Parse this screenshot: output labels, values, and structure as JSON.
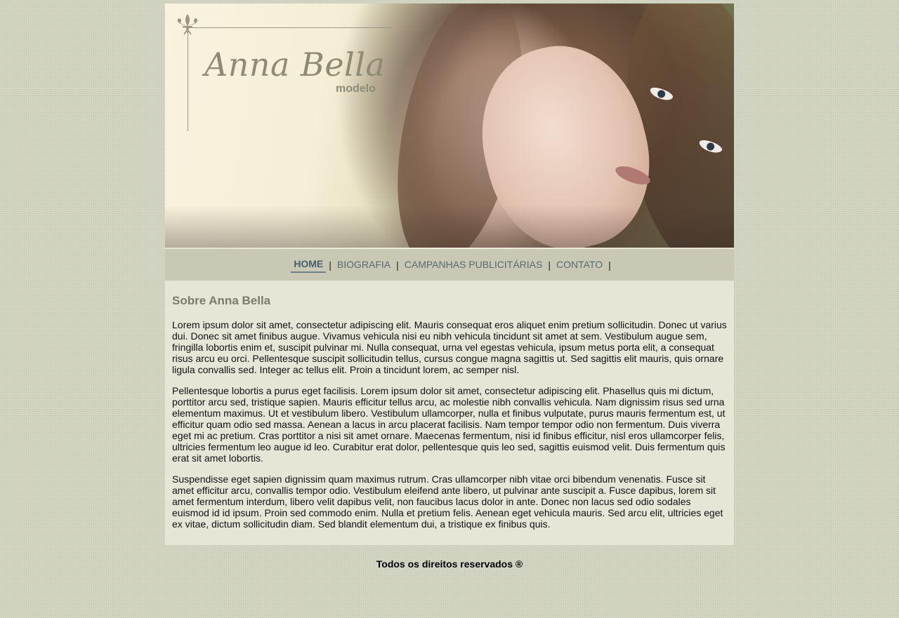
{
  "brand": {
    "name": "Anna Bella",
    "subtitle": "modelo"
  },
  "nav": {
    "items": [
      {
        "label": "HOME",
        "active": true
      },
      {
        "label": "BIOGRAFIA",
        "active": false
      },
      {
        "label": "CAMPANHAS PUBLICITÁRIAS",
        "active": false
      },
      {
        "label": "CONTATO",
        "active": false
      }
    ],
    "separator": "|"
  },
  "content": {
    "heading": "Sobre Anna Bella",
    "paragraphs": [
      "Lorem ipsum dolor sit amet, consectetur adipiscing elit. Mauris consequat eros aliquet enim pretium sollicitudin. Donec ut varius dui. Donec sit amet finibus augue. Vivamus vehicula nisi eu nibh vehicula tincidunt sit amet at sem. Vestibulum augue sem, fringilla lobortis enim et, suscipit pulvinar mi. Nulla consequat, urna vel egestas vehicula, ipsum metus porta elit, a consequat risus arcu eu orci. Pellentesque suscipit sollicitudin tellus, cursus congue magna sagittis ut. Sed sagittis elit mauris, quis ornare ligula convallis sed. Integer ac tellus elit. Proin a tincidunt lorem, ac semper nisl.",
      "Pellentesque lobortis a purus eget facilisis. Lorem ipsum dolor sit amet, consectetur adipiscing elit. Phasellus quis mi dictum, porttitor arcu sed, tristique sapien. Mauris efficitur tellus arcu, ac molestie nibh convallis vehicula. Nam dignissim risus sed urna elementum maximus. Ut et vestibulum libero. Vestibulum ullamcorper, nulla et finibus vulputate, purus mauris fermentum est, ut efficitur quam odio sed massa. Aenean a lacus in arcu placerat facilisis. Nam tempor tempor odio non fermentum. Duis viverra eget mi ac pretium. Cras porttitor a nisi sit amet ornare. Maecenas fermentum, nisi id finibus efficitur, nisl eros ullamcorper felis, ultricies fermentum leo augue id leo. Curabitur erat dolor, pellentesque quis leo sed, sagittis euismod velit. Duis fermentum quis erat sit amet lobortis.",
      "Suspendisse eget sapien dignissim quam maximus rutrum. Cras ullamcorper nibh vitae orci bibendum venenatis. Fusce sit amet efficitur arcu, convallis tempor odio. Vestibulum eleifend ante libero, ut pulvinar ante suscipit a. Fusce dapibus, lorem sit amet fermentum interdum, libero velit dapibus velit, non faucibus lacus dolor in ante. Donec non lacus sed odio sodales euismod id id ipsum. Proin sed commodo enim. Nulla et pretium felis. Aenean eget vehicula mauris. Sed arcu elit, ultricies eget ex vitae, dictum sollicitudin diam. Sed blandit elementum dui, a tristique ex finibus quis."
    ]
  },
  "footer": {
    "text": "Todos os direitos reservados ®"
  },
  "colors": {
    "page_bg": "#d3d4c3",
    "nav_bg": "#c8c8b4",
    "content_bg": "#e6e6d7",
    "nav_link": "#5a6a72",
    "heading": "#7b7b6c",
    "brand": "#8d8a76"
  },
  "icons": {
    "brand_ornament": "fleur-de-lis-icon"
  }
}
